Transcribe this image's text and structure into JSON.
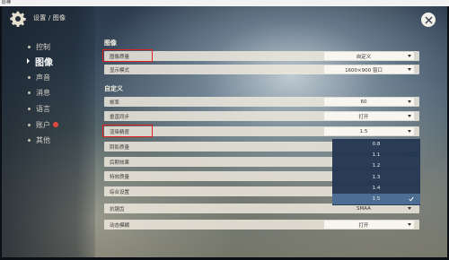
{
  "window": {
    "title": "原神"
  },
  "header": {
    "breadcrumb": "设置 / 图像"
  },
  "sidebar": {
    "items": [
      {
        "label": "控制",
        "active": false
      },
      {
        "label": "图像",
        "active": true
      },
      {
        "label": "声音",
        "active": false
      },
      {
        "label": "消息",
        "active": false
      },
      {
        "label": "语言",
        "active": false
      },
      {
        "label": "账户",
        "active": false,
        "badge": true
      },
      {
        "label": "其他",
        "active": false
      }
    ]
  },
  "sections": {
    "image": "图像",
    "custom": "自定义"
  },
  "settings": {
    "graphics_quality": {
      "label": "图像质量",
      "value": "自定义"
    },
    "display_mode": {
      "label": "显示模式",
      "value": "1600×900 窗口"
    },
    "frame_rate": {
      "label": "帧率",
      "value": "60"
    },
    "vsync": {
      "label": "垂直同步",
      "value": "打开"
    },
    "render_resolution": {
      "label": "渲染精度",
      "value": "1.5"
    },
    "shadow_quality": {
      "label": "阴影质量"
    },
    "post_processing": {
      "label": "后期效果"
    },
    "fx_quality": {
      "label": "特效质量"
    },
    "scene_detail": {
      "label": "综合设置"
    },
    "anti_aliasing": {
      "label": "抗锯齿",
      "value": "SMAA"
    },
    "motion_blur": {
      "label": "动态模糊",
      "value": "打开"
    }
  },
  "dropdown": {
    "options": [
      "0.8",
      "1.1",
      "1.2",
      "1.3",
      "1.4",
      "1.5"
    ],
    "selected": "1.5"
  },
  "colors": {
    "highlight": "#e02020",
    "dropdown_bg": "#243752",
    "dropdown_selected": "#4e6d93"
  }
}
